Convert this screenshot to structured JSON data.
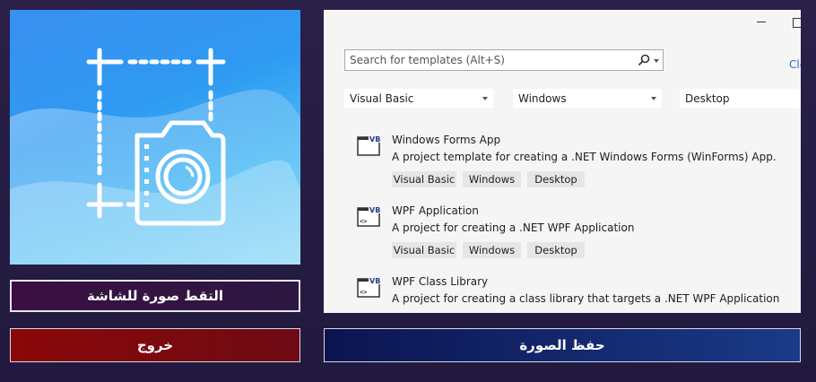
{
  "app": {
    "capture_button": "التقط صورة للشاشة",
    "exit_button": "خروج",
    "save_button": "حفظ الصورة"
  },
  "vs_dialog": {
    "search": {
      "placeholder": "Search for templates (Alt+S)",
      "value": ""
    },
    "clear_link": "Cle",
    "filters": {
      "language": "Visual Basic",
      "platform": "Windows",
      "project_type": "Desktop"
    },
    "templates": [
      {
        "title": "Windows Forms App",
        "description": "A project template for creating a .NET Windows Forms (WinForms) App.",
        "icon": "vb-windows-forms-icon",
        "badge": "VB",
        "tags": [
          "Visual Basic",
          "Windows",
          "Desktop"
        ]
      },
      {
        "title": "WPF Application",
        "description": "A project for creating a .NET WPF Application",
        "icon": "vb-wpf-icon",
        "badge": "VB",
        "tags": [
          "Visual Basic",
          "Windows",
          "Desktop"
        ]
      },
      {
        "title": "WPF Class Library",
        "description": "A project for creating a class library that targets a .NET WPF Application",
        "icon": "vb-wpf-library-icon",
        "badge": "VB",
        "tags": []
      }
    ]
  },
  "colors": {
    "background": "#2a2048",
    "capture_button": "#3a1040",
    "exit_button": "#8a0808",
    "save_button": "#1a3a88",
    "logo_blue": "#3a8ff0",
    "vs_link": "#2b6cc4"
  }
}
